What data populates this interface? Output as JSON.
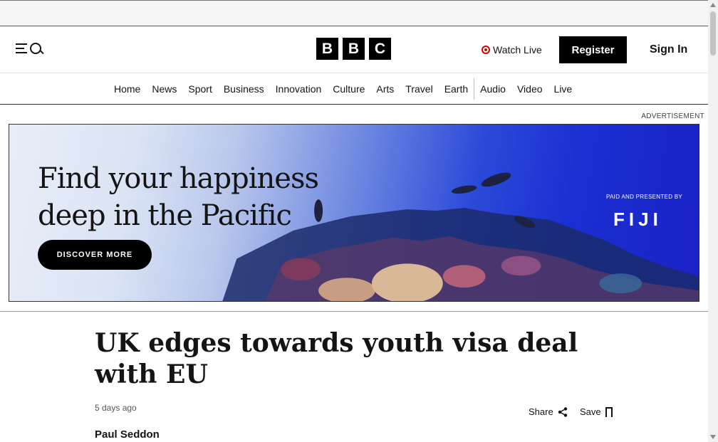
{
  "header": {
    "watch_live": "Watch Live",
    "register": "Register",
    "sign_in": "Sign In",
    "logo_letters": [
      "B",
      "B",
      "C"
    ],
    "live_color": "#d30000"
  },
  "nav": {
    "items": [
      "Home",
      "News",
      "Sport",
      "Business",
      "Innovation",
      "Culture",
      "Arts",
      "Travel",
      "Earth",
      "Audio",
      "Video",
      "Live"
    ]
  },
  "ad": {
    "label": "ADVERTISEMENT",
    "headline_line1": "Find your happiness",
    "headline_line2": "deep in the Pacific",
    "cta": "DISCOVER MORE",
    "sponsor": "PAID AND PRESENTED BY",
    "brand": "FIJI"
  },
  "article": {
    "title": "UK edges towards youth visa deal with EU",
    "timestamp": "5 days ago",
    "share_label": "Share",
    "save_label": "Save",
    "author": "Paul Seddon"
  }
}
